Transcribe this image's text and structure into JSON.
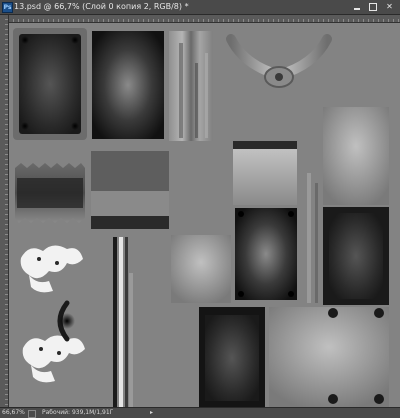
{
  "window": {
    "title": "13.psd @ 66,7% (Слой 0 копия 2, RGB/8) *",
    "app_icon_text": "Ps",
    "minimize_symbol": "",
    "maximize_symbol": "",
    "close_symbol": "✕"
  },
  "status": {
    "zoom": "66,67%",
    "doc_info": "Рабочий: 939,1M/1,91Г",
    "arrow": "▸"
  },
  "colors": {
    "canvas_bg": "#838383",
    "chrome": "#4a4a4a"
  }
}
